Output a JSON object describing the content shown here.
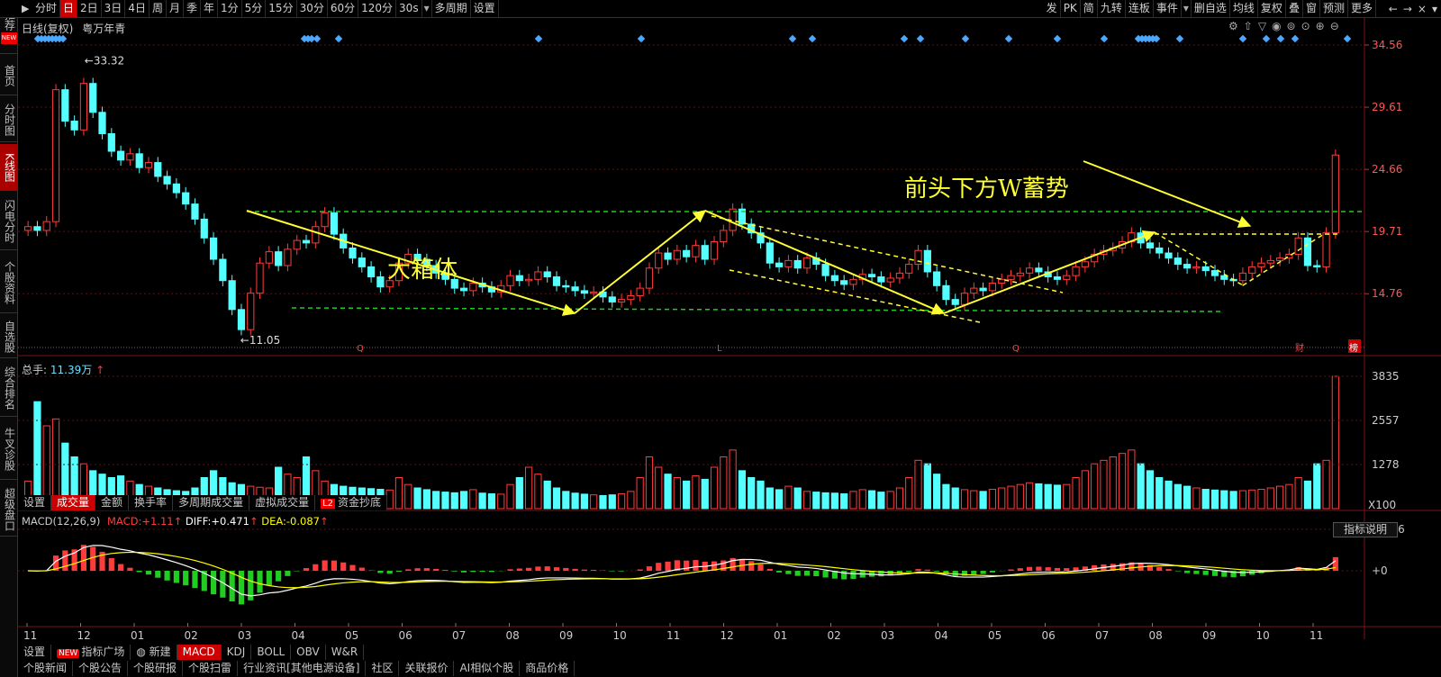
{
  "toolbar": {
    "left_items": [
      "分时",
      "日",
      "2日",
      "3日",
      "4日",
      "周",
      "月",
      "季",
      "年",
      "1分",
      "5分",
      "15分",
      "30分",
      "60分",
      "120分",
      "30s",
      "多周期",
      "设置"
    ],
    "active": "日",
    "right_items": [
      "发",
      "PK",
      "简",
      "九转",
      "连板",
      "事件",
      "",
      "删自选",
      "均线",
      "复权",
      "叠",
      "窗",
      "预测",
      "更多"
    ],
    "window_controls": [
      "←",
      "→",
      "×",
      "▾"
    ]
  },
  "sidebar": [
    {
      "label": "推荐",
      "badge": "NEW"
    },
    {
      "label": "首页"
    },
    {
      "label": "分时图"
    },
    {
      "label": "K线图",
      "active": true
    },
    {
      "label": "闪电分时"
    },
    {
      "label": "个股资料"
    },
    {
      "label": "自选股"
    },
    {
      "label": "综合排名"
    },
    {
      "label": "牛叉诊股"
    },
    {
      "label": "超级盘口"
    }
  ],
  "chart_header": {
    "mode": "日线(复权)",
    "stock": "粤万年青"
  },
  "price_axis": [
    "34.56",
    "29.61",
    "24.66",
    "19.71",
    "14.76"
  ],
  "high_label": "33.32",
  "low_label": "11.05",
  "annotations": [
    "大箱体",
    "前头下方W蓄势"
  ],
  "event_markers": [
    "Q",
    "L",
    "Q",
    "财",
    "榜"
  ],
  "volume": {
    "title": "总手:",
    "value": "11.39万",
    "axis": [
      "3835",
      "2557",
      "1278",
      "X100"
    ]
  },
  "volume_tabs": [
    "设置",
    "成交量",
    "金额",
    "换手率",
    "多周期成交量",
    "虚拟成交量",
    "资金抄底"
  ],
  "volume_tab_active": "成交量",
  "macd": {
    "params": "MACD(12,26,9)",
    "macd_label": "MACD:",
    "macd_val": "+1.11",
    "diff_label": "DIFF:",
    "diff_val": "+0.471",
    "dea_label": "DEA:",
    "dea_val": "-0.087",
    "axis": [
      "+2.56",
      "+0"
    ],
    "explain_button": "指标说明"
  },
  "months": [
    "11",
    "12",
    "01",
    "02",
    "03",
    "04",
    "05",
    "06",
    "07",
    "08",
    "09",
    "10",
    "11",
    "12",
    "01",
    "02",
    "03",
    "04",
    "05",
    "06",
    "07",
    "08",
    "09",
    "10",
    "11"
  ],
  "indicator_tabs": [
    "设置",
    "指标广场",
    "新建",
    "MACD",
    "KDJ",
    "BOLL",
    "OBV",
    "W&R"
  ],
  "indicator_tab_active": "MACD",
  "bottom_tabs": [
    "个股新闻",
    "个股公告",
    "个股研报",
    "个股扫雷",
    "行业资讯[其他电源设备]",
    "社区",
    "关联报价",
    "AI相似个股",
    "商品价格"
  ],
  "colors": {
    "up": "#ff3c3c",
    "down": "#54ffff",
    "annotation": "#ffff33",
    "box_line": "#22cc22",
    "macd_up": "#ff3c3c",
    "macd_down": "#22cc22",
    "diff": "#ffffff",
    "dea": "#ffff00"
  },
  "chart_data": {
    "type": "candlestick",
    "price_range": [
      11.05,
      34.56
    ],
    "close": [
      20.1,
      19.8,
      20.5,
      31.0,
      28.5,
      27.8,
      31.5,
      29.2,
      27.5,
      26.1,
      25.4,
      25.9,
      24.8,
      25.2,
      24.1,
      23.5,
      22.8,
      21.9,
      20.7,
      19.2,
      17.5,
      15.8,
      13.5,
      11.9,
      14.8,
      17.2,
      18.1,
      17.0,
      18.3,
      19.0,
      18.8,
      20.1,
      21.2,
      19.5,
      18.4,
      17.6,
      16.9,
      16.1,
      15.3,
      15.8,
      17.2,
      17.9,
      17.5,
      17.0,
      16.4,
      15.9,
      15.2,
      15.0,
      15.6,
      15.3,
      14.9,
      15.4,
      16.2,
      15.8,
      15.9,
      16.5,
      16.1,
      15.4,
      15.3,
      15.0,
      14.8,
      14.9,
      14.5,
      14.1,
      14.3,
      14.6,
      15.2,
      16.8,
      18.0,
      17.5,
      18.2,
      17.7,
      18.6,
      17.5,
      18.9,
      19.8,
      21.5,
      20.3,
      19.6,
      18.8,
      17.2,
      16.9,
      17.4,
      16.8,
      17.6,
      17.1,
      16.2,
      15.8,
      15.5,
      15.9,
      16.3,
      16.1,
      15.7,
      16.0,
      16.4,
      17.1,
      18.2,
      16.5,
      15.4,
      14.3,
      13.9,
      14.8,
      15.2,
      15.0,
      15.6,
      15.9,
      16.2,
      16.4,
      16.8,
      16.5,
      16.1,
      15.9,
      16.2,
      16.9,
      17.3,
      17.9,
      18.2,
      18.4,
      18.9,
      19.6,
      18.8,
      18.4,
      18.0,
      17.6,
      17.1,
      16.8,
      16.9,
      16.6,
      16.2,
      15.9,
      15.8,
      16.4,
      16.9,
      17.2,
      17.4,
      17.6,
      17.9,
      19.2,
      17.0,
      16.9,
      19.6,
      25.8
    ],
    "volume": [
      800,
      3100,
      2400,
      2600,
      1900,
      1500,
      1300,
      1100,
      1000,
      900,
      950,
      800,
      700,
      650,
      600,
      550,
      520,
      500,
      600,
      900,
      1100,
      900,
      750,
      700,
      650,
      620,
      600,
      1200,
      1000,
      900,
      1500,
      1100,
      800,
      700,
      650,
      620,
      600,
      580,
      560,
      540,
      900,
      700,
      600,
      550,
      500,
      480,
      460,
      500,
      550,
      450,
      430,
      420,
      700,
      900,
      1200,
      1000,
      800,
      600,
      500,
      450,
      420,
      400,
      380,
      400,
      430,
      500,
      900,
      1500,
      1200,
      1000,
      900,
      800,
      950,
      850,
      1200,
      1500,
      1700,
      1100,
      900,
      800,
      600,
      550,
      650,
      600,
      500,
      480,
      460,
      450,
      430,
      500,
      550,
      520,
      480,
      500,
      600,
      900,
      1400,
      1300,
      1000,
      700,
      600,
      550,
      520,
      500,
      560,
      600,
      650,
      700,
      750,
      720,
      700,
      680,
      700,
      900,
      1100,
      1300,
      1400,
      1500,
      1600,
      1700,
      1300,
      1100,
      900,
      800,
      700,
      650,
      600,
      560,
      540,
      520,
      500,
      520,
      540,
      560,
      600,
      650,
      700,
      900,
      800,
      1300,
      1400,
      3835
    ]
  }
}
